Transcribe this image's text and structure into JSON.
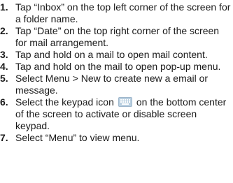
{
  "steps": [
    {
      "number": "1.",
      "text": "Tap “Inbox” on the top left corner of the screen for a folder name."
    },
    {
      "number": "2.",
      "text": "Tap “Date” on the top right corner of the screen for mail arrangement."
    },
    {
      "number": "3.",
      "text": "Tap and hold on a mail to open mail content."
    },
    {
      "number": "4.",
      "text": "Tap and hold on the mail to open pop-up menu."
    },
    {
      "number": "5.",
      "text": "Select Menu > New to create new a email or message."
    },
    {
      "number": "6.",
      "text_before_icon": "Select the keypad icon",
      "icon": "keypad-icon",
      "text_after_icon": "on the bottom center of the screen to activate or disable screen keypad."
    },
    {
      "number": "7.",
      "text": "Select “Menu” to view menu."
    }
  ]
}
